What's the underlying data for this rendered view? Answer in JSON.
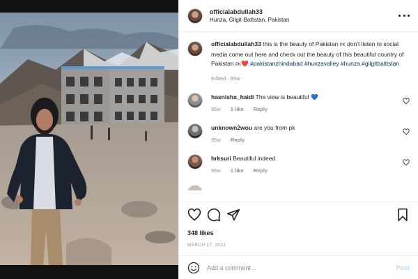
{
  "header": {
    "username": "officialabdullah33",
    "location": "Hunza, Gilgit-Baltistan, Pakistan",
    "more_icon": "more-horizontal-icon"
  },
  "caption": {
    "username": "officialabdullah33",
    "text": "this is the beauty of Pakistan",
    "flag1": "PK",
    "text2": "don't listen to social media come out here and check out the beauty of this beautiful country of Pakistan",
    "flag2": "PK",
    "heart": "❤️",
    "hashtags": "#pakistanzhindabad #hunzavalley #hunza #gilgitbaltistan",
    "edited": "Edited · 95w"
  },
  "comments": [
    {
      "username": "hasnisha_haidi",
      "text": "The view is beautiful",
      "emoji": "💙",
      "age": "95w",
      "likes": "1 like",
      "reply": "Reply"
    },
    {
      "username": "unknown2wou",
      "text": "are you from pk",
      "emoji": "",
      "age": "95w",
      "likes": "",
      "reply": "Reply"
    },
    {
      "username": "hrksuri",
      "text": "Beautiful indeed",
      "emoji": "",
      "age": "95w",
      "likes": "1 like",
      "reply": "Reply"
    }
  ],
  "actions": {
    "likes": "348 likes",
    "date": "MARCH 17, 2021"
  },
  "add_comment": {
    "placeholder": "Add a comment...",
    "post_label": "Post"
  },
  "colors": {
    "link_blue": "#00376b",
    "post_blue": "#b2dffc",
    "meta_gray": "#8e8e8e",
    "heart_red": "#ed4956"
  }
}
